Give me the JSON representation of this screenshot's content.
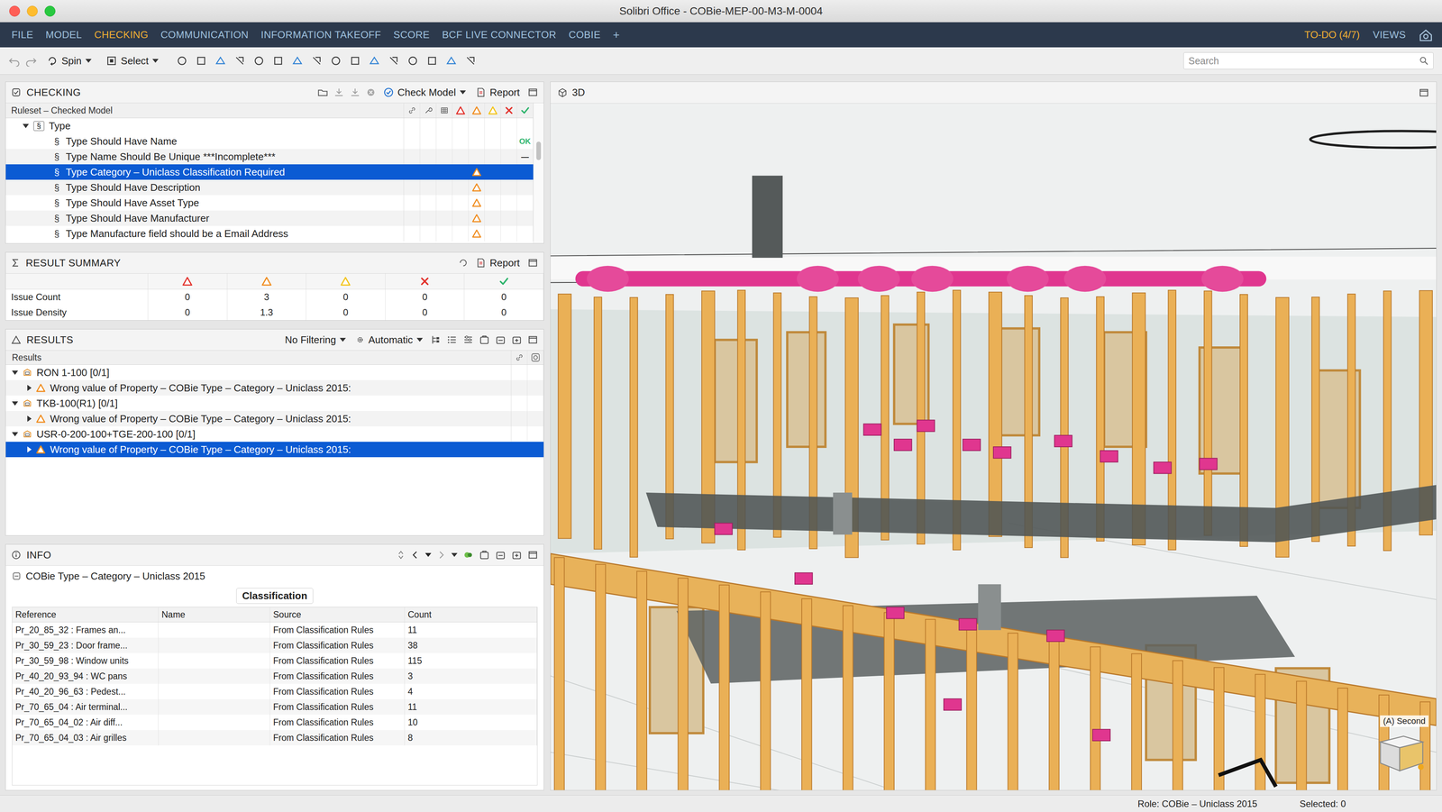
{
  "window": {
    "title": "Solibri Office - COBie-MEP-00-M3-M-0004"
  },
  "menu": {
    "items": [
      {
        "label": "FILE",
        "selected": false
      },
      {
        "label": "MODEL",
        "selected": false
      },
      {
        "label": "CHECKING",
        "selected": true
      },
      {
        "label": "COMMUNICATION",
        "selected": false
      },
      {
        "label": "INFORMATION TAKEOFF",
        "selected": false
      },
      {
        "label": "SCORE",
        "selected": false
      },
      {
        "label": "BCF LIVE CONNECTOR",
        "selected": false
      },
      {
        "label": "COBIE",
        "selected": false
      }
    ],
    "add": "+",
    "todo": "TO-DO (4/7)",
    "views": "VIEWS"
  },
  "toolbar": {
    "spin": "Spin",
    "select": "Select",
    "search": {
      "placeholder": "Search"
    }
  },
  "checking": {
    "title": "CHECKING",
    "check_model": "Check Model",
    "report": "Report",
    "column": "Ruleset – Checked Model",
    "section": "§",
    "group": {
      "label": "Type",
      "expanded": true
    },
    "rules": [
      {
        "label": "Type Should Have Name",
        "selected": false,
        "column": "accepted",
        "kind": "text",
        "mark": "OK",
        "color": "#2db46c"
      },
      {
        "label": "Type Name Should Be Unique ***Incomplete***",
        "selected": false,
        "column": "accepted",
        "kind": "text",
        "mark": "—",
        "color": "#1e1e1e"
      },
      {
        "label": "Type Category – Uniclass Classification Required",
        "selected": true,
        "column": "moderate",
        "kind": "icon"
      },
      {
        "label": "Type Should Have Description",
        "selected": false,
        "column": "moderate",
        "kind": "icon"
      },
      {
        "label": "Type Should Have Asset Type",
        "selected": false,
        "column": "moderate",
        "kind": "icon"
      },
      {
        "label": "Type Should Have Manufacturer",
        "selected": false,
        "column": "moderate",
        "kind": "icon"
      },
      {
        "label": "Type Manufacture field should be a Email Address",
        "selected": false,
        "column": "moderate",
        "kind": "icon"
      }
    ]
  },
  "summary": {
    "title": "RESULT SUMMARY",
    "report": "Report",
    "columns": [
      {
        "kind": "critical"
      },
      {
        "kind": "moderate"
      },
      {
        "kind": "low"
      },
      {
        "kind": "rejected"
      },
      {
        "kind": "accepted"
      }
    ],
    "rows": [
      {
        "label": "Issue Count",
        "values": [
          "0",
          "3",
          "0",
          "0",
          "0"
        ]
      },
      {
        "label": "Issue Density",
        "values": [
          "0",
          "1.3",
          "0",
          "0",
          "0"
        ]
      }
    ]
  },
  "results": {
    "title": "RESULTS",
    "filter": "No Filtering",
    "mode": "Automatic",
    "column": "Results",
    "groups": [
      {
        "label": "RON 1-100 [0/1]",
        "expanded": true,
        "issue": {
          "label": "Wrong value of Property – COBie Type – Category – Uniclass 2015:",
          "severity": "moderate",
          "expanded": false,
          "selected": false
        }
      },
      {
        "label": "TKB-100(R1) [0/1]",
        "expanded": true,
        "issue": {
          "label": "Wrong value of Property – COBie Type – Category – Uniclass 2015:",
          "severity": "moderate",
          "expanded": false,
          "selected": false
        }
      },
      {
        "label": "USR-0-200-100+TGE-200-100 [0/1]",
        "expanded": true,
        "issue": {
          "label": "Wrong value of Property – COBie Type – Category – Uniclass 2015:",
          "severity": "moderate",
          "expanded": false,
          "selected": true
        }
      }
    ]
  },
  "info": {
    "title": "INFO",
    "heading": "COBie Type – Category – Uniclass 2015",
    "tab": {
      "label": "Classification",
      "selected": true
    },
    "columns": [
      "Reference",
      "Name",
      "Source",
      "Count"
    ],
    "rows": [
      {
        "reference": "Pr_20_85_32 : Frames an...",
        "name": "",
        "source": "From Classification Rules",
        "count": "11"
      },
      {
        "reference": "Pr_30_59_23 : Door frame...",
        "name": "",
        "source": "From Classification Rules",
        "count": "38"
      },
      {
        "reference": "Pr_30_59_98 : Window units",
        "name": "",
        "source": "From Classification Rules",
        "count": "115"
      },
      {
        "reference": "Pr_40_20_93_94 : WC pans",
        "name": "",
        "source": "From Classification Rules",
        "count": "3"
      },
      {
        "reference": "Pr_40_20_96_63 : Pedest...",
        "name": "",
        "source": "From Classification Rules",
        "count": "4"
      },
      {
        "reference": "Pr_70_65_04 : Air terminal...",
        "name": "",
        "source": "From Classification Rules",
        "count": "11"
      },
      {
        "reference": "Pr_70_65_04_02 : Air diff...",
        "name": "",
        "source": "From Classification Rules",
        "count": "10"
      },
      {
        "reference": "Pr_70_65_04_03 : Air grilles",
        "name": "",
        "source": "From Classification Rules",
        "count": "8"
      }
    ]
  },
  "viewer": {
    "title": "3D",
    "view_label": "(A) Second"
  },
  "status_bar": {
    "role": "Role: COBie – Uniclass 2015",
    "selected": "Selected: 0"
  }
}
